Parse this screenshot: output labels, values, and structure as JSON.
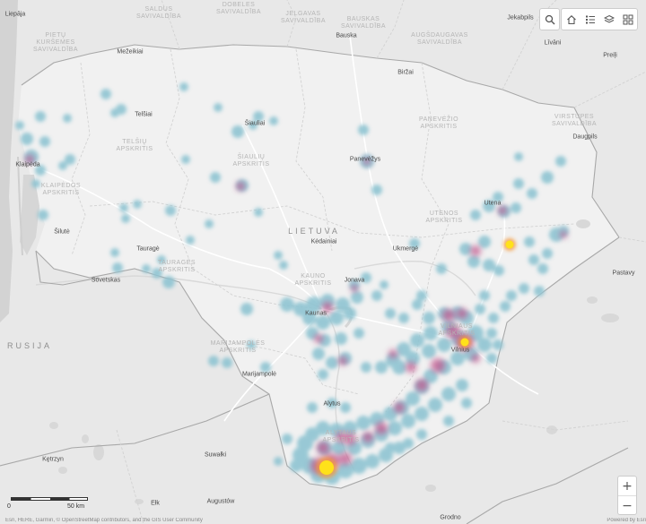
{
  "map": {
    "country": "LIETUVA",
    "neighbor_country": "RUSIJA",
    "regions": [
      {
        "name": "KLAIPĖDOS\nAPSKRITIS"
      },
      {
        "name": "TELŠIŲ\nAPSKRITIS"
      },
      {
        "name": "ŠIAULIŲ\nAPSKRITIS"
      },
      {
        "name": "PANEVĖŽIO\nAPSKRITIS"
      },
      {
        "name": "UTENOS\nAPSKRITIS"
      },
      {
        "name": "TAURAGĖS\nAPSKRITIS"
      },
      {
        "name": "KAUNO\nAPSKRITIS"
      },
      {
        "name": "MARIJAMPOLĖS\nAPSKRITIS"
      },
      {
        "name": "VILNIAUS\nAPSKRITIS"
      },
      {
        "name": "ALYTAUS\nAPSKRITIS"
      },
      {
        "name": "PIETŲ\nKURŠEMES\nSAVIVALDĪBA"
      },
      {
        "name": "SALDUS\nSAVIVALDĪBA"
      },
      {
        "name": "DOBELES\nSAVIVALDĪBA"
      },
      {
        "name": "JELGAVAS\nSAVIVALDĪBA"
      },
      {
        "name": "BAUSKAS\nSAVIVALDĪBA"
      },
      {
        "name": "AUGŠDAUGAVAS\nSAVIVALDĪBA"
      },
      {
        "name": "VIRSTUPES\nSAVIVALDĪBA"
      }
    ],
    "cities": [
      "Liepāja",
      "Mežeikiai",
      "Telšiai",
      "Šiauliai",
      "Klaipėda",
      "Šilutė",
      "Tauragė",
      "Sovetskas",
      "Panevėžys",
      "Kėdainiai",
      "Ukmergė",
      "Jonava",
      "Kaunas",
      "Marijampolė",
      "Alytus",
      "Vilnius",
      "Utena",
      "Bauska",
      "Biržai",
      "Jekabpils",
      "Līvāni",
      "Preiļi",
      "Daugpils",
      "Pastavy",
      "Suwałki",
      "Kętrzyn",
      "Ełk",
      "Augustów",
      "Grodno"
    ],
    "heatmap": {
      "type": "heatmap",
      "ramp": [
        "#8fc4d2",
        "#c0548c",
        "#ffe11a"
      ],
      "hotspots": [
        {
          "place": "Lazdijai area",
          "intensity": 1.0
        },
        {
          "place": "Vilnius",
          "intensity": 0.9
        },
        {
          "place": "Utena area",
          "intensity": 0.85
        },
        {
          "place": "Kaunas",
          "intensity": 0.6
        },
        {
          "place": "Klaipėda",
          "intensity": 0.5
        }
      ]
    }
  },
  "toolbar": {
    "search_icon": "search-icon",
    "home_icon": "home-icon",
    "legend_icon": "legend-icon",
    "layers_icon": "layers-icon",
    "basemap_icon": "basemap-gallery-icon"
  },
  "zoom": {
    "in": "+",
    "out": "−"
  },
  "scale": {
    "zero": "0",
    "fifty": "50 km"
  },
  "attribution": "Esri, HERE, Garmin, © OpenStreetMap contributors, and the GIS User Community",
  "powered": "Powered by Esri"
}
